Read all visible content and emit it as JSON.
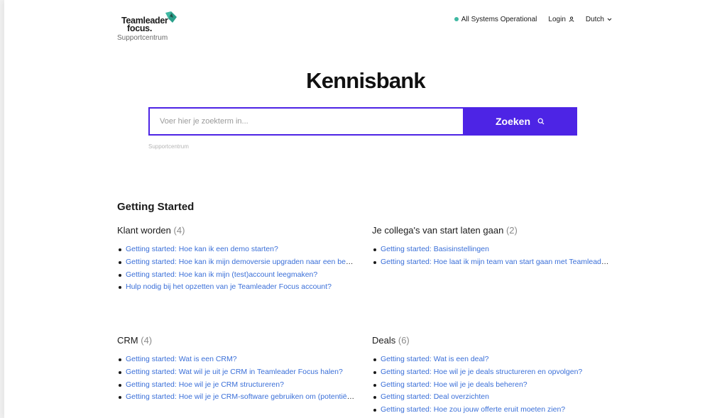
{
  "header": {
    "logo_line1": "Teamleader",
    "logo_line2": "focus.",
    "logo_sub": "Supportcentrum",
    "status": "All Systems Operational",
    "login": "Login",
    "language": "Dutch",
    "colors": {
      "status": "#3fb8a2",
      "accent": "#4d24e5",
      "link": "#3a6fd8"
    }
  },
  "hero": {
    "title": "Kennisbank",
    "search_placeholder": "Voer hier je zoekterm in...",
    "search_button": "Zoeken",
    "breadcrumb": "Supportcentrum"
  },
  "section": {
    "title": "Getting Started",
    "categories": [
      {
        "title": "Klant worden",
        "count": "(4)",
        "articles": [
          "Getting started: Hoe kan ik een demo starten?",
          "Getting started: Hoe kan ik mijn demoversie upgraden naar een betaalde versie?",
          "Getting started: Hoe kan ik mijn (test)account leegmaken?",
          "Hulp nodig bij het opzetten van je Teamleader Focus account?"
        ]
      },
      {
        "title": "Je collega's van start laten gaan",
        "count": "(2)",
        "articles": [
          "Getting started: Basisinstellingen",
          "Getting started: Hoe laat ik mijn team van start gaan met Teamleader Focus?"
        ]
      },
      {
        "title": "CRM",
        "count": "(4)",
        "articles": [
          "Getting started: Wat is een CRM?",
          "Getting started: Wat wil je uit je CRM in Teamleader Focus halen?",
          "Getting started: Hoe wil je je CRM structureren?",
          "Getting started: Hoe wil je je CRM-software gebruiken om (potentiële) klanten te bereiken?"
        ]
      },
      {
        "title": "Deals",
        "count": "(6)",
        "articles": [
          "Getting started: Wat is een deal?",
          "Getting started: Hoe wil je je deals structureren en opvolgen?",
          "Getting started: Hoe wil je je deals beheren?",
          "Getting started: Deal overzichten",
          "Getting started: Hoe zou jouw offerte eruit moeten zien?"
        ]
      }
    ]
  }
}
